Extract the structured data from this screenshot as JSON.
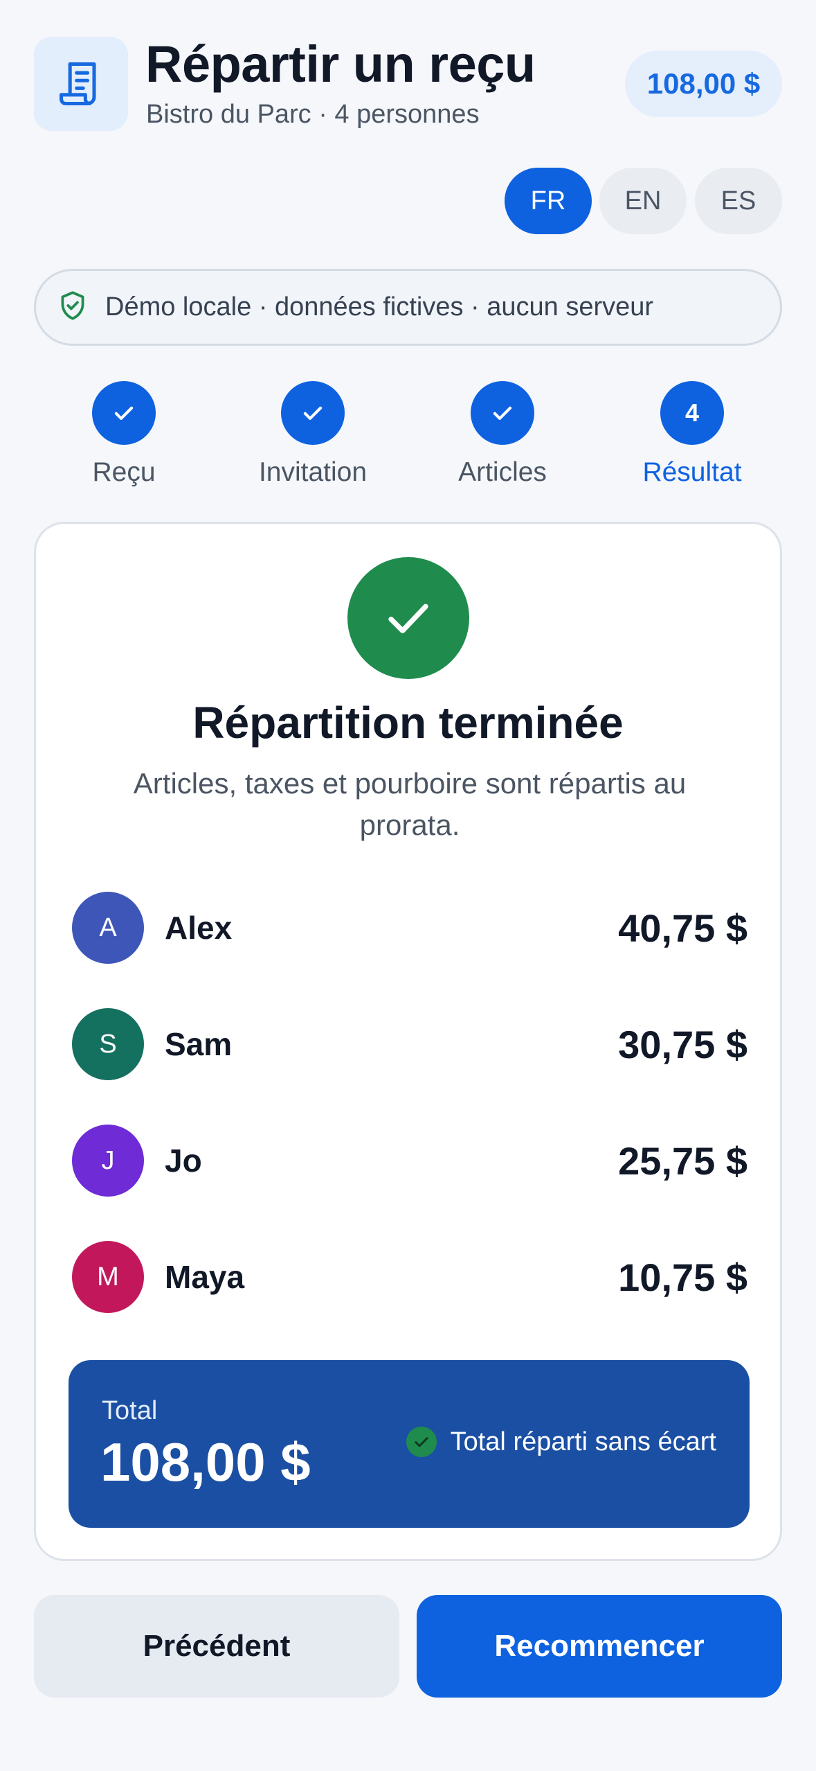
{
  "header": {
    "title": "Répartir un reçu",
    "subtitle": "Bistro du Parc · 4 personnes",
    "total_pill": "108,00 $",
    "icon": "receipt-icon"
  },
  "languages": [
    {
      "label": "FR",
      "active": true
    },
    {
      "label": "EN",
      "active": false
    },
    {
      "label": "ES",
      "active": false
    }
  ],
  "banner": {
    "icon": "shield-check-icon",
    "text": "Démo locale · données fictives · aucun serveur"
  },
  "steps": [
    {
      "label": "Reçu",
      "state": "done",
      "marker": ""
    },
    {
      "label": "Invitation",
      "state": "done",
      "marker": ""
    },
    {
      "label": "Articles",
      "state": "done",
      "marker": ""
    },
    {
      "label": "Résultat",
      "state": "current",
      "marker": "4"
    }
  ],
  "result": {
    "icon": "checkmark-icon",
    "title": "Répartition terminée",
    "description": "Articles, taxes et pourboire sont répartis au prorata.",
    "people": [
      {
        "initial": "A",
        "name": "Alex",
        "amount": "40,75 $",
        "color": "#3d56b8"
      },
      {
        "initial": "S",
        "name": "Sam",
        "amount": "30,75 $",
        "color": "#14705f"
      },
      {
        "initial": "J",
        "name": "Jo",
        "amount": "25,75 $",
        "color": "#6e2bd6"
      },
      {
        "initial": "M",
        "name": "Maya",
        "amount": "10,75 $",
        "color": "#c2185b"
      }
    ],
    "total_label": "Total",
    "total_value": "108,00 $",
    "status_text": "Total réparti sans écart"
  },
  "buttons": {
    "previous": "Précédent",
    "restart": "Recommencer"
  },
  "colors": {
    "accent": "#0e62e0",
    "success": "#1f8c4e",
    "total_bg": "#1a4fa3"
  }
}
